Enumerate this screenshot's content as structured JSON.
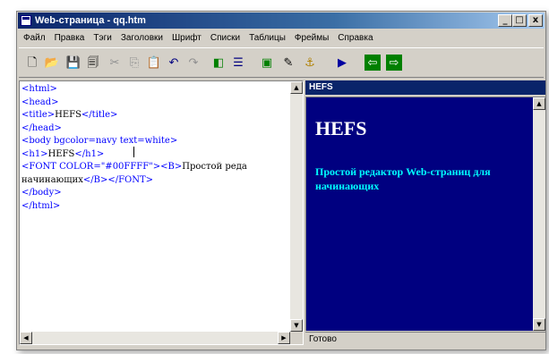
{
  "window": {
    "title": "Web-страница - qq.htm",
    "minimize": "_",
    "maximize": "□",
    "close": "x"
  },
  "menu": [
    "Файл",
    "Правка",
    "Тэги",
    "Заголовки",
    "Шрифт",
    "Списки",
    "Таблицы",
    "Фреймы",
    "Справка"
  ],
  "toolbar": {
    "new": "🗋",
    "open": "📂",
    "save": "💾",
    "save_all": "🗐",
    "cut": "✂",
    "copy": "⎘",
    "paste": "📋",
    "undo": "↶",
    "redo": "↷",
    "split_view": "◧",
    "text_view": "☰",
    "preview": "▣",
    "edit": "✎",
    "anchor": "⚓",
    "run": "▶",
    "back": "⇦",
    "forward": "⇨"
  },
  "editor": {
    "lines": [
      [
        {
          "t": "<html>",
          "c": "tag"
        }
      ],
      [
        {
          "t": "<head>",
          "c": "tag"
        }
      ],
      [
        {
          "t": "<title>",
          "c": "tag"
        },
        {
          "t": "HEFS",
          "c": "txt"
        },
        {
          "t": "</title>",
          "c": "tag"
        }
      ],
      [
        {
          "t": "</head>",
          "c": "tag"
        }
      ],
      [
        {
          "t": "<body bgcolor=navy text=white>",
          "c": "tag"
        }
      ],
      [
        {
          "t": "<h1>",
          "c": "tag"
        },
        {
          "t": "HEFS",
          "c": "txt"
        },
        {
          "t": "</h1>",
          "c": "tag"
        }
      ],
      [
        {
          "t": "<FONT COLOR=\"#00FFFF\">",
          "c": "tag"
        },
        {
          "t": "<B>",
          "c": "tag"
        },
        {
          "t": "Простой реда",
          "c": "txt"
        }
      ],
      [
        {
          "t": "начинающих",
          "c": "txt"
        },
        {
          "t": "</B>",
          "c": "tag"
        },
        {
          "t": "</FONT>",
          "c": "tag"
        }
      ],
      [
        {
          "t": "</body>",
          "c": "tag"
        }
      ],
      [
        {
          "t": "</html>",
          "c": "tag"
        }
      ]
    ]
  },
  "preview": {
    "header": "HEFS",
    "heading": "HEFS",
    "text": "Простой редактор Web-страниц для начинающих"
  },
  "status": "Готово",
  "scroll_glyphs": {
    "up": "▲",
    "down": "▼",
    "left": "◀",
    "right": "▶"
  },
  "colors": {
    "title_bar": "#0a246a",
    "preview_bg": "#000080",
    "preview_heading": "#ffffff",
    "preview_text": "#00ffff",
    "code_tag": "#0000ff",
    "code_text": "#000000"
  }
}
